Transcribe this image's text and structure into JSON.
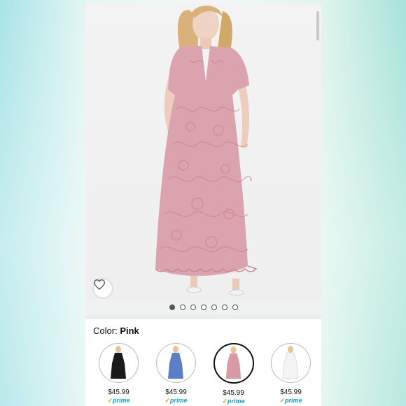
{
  "product": {
    "images_count": 7,
    "active_image_index": 0
  },
  "color_selector": {
    "label": "Color:",
    "selected": "Pink",
    "options": [
      {
        "color_hex": "#1a1a1a",
        "price": "$45.99",
        "prime": "prime"
      },
      {
        "color_hex": "#5b7fc4",
        "price": "$45.99",
        "prime": "prime"
      },
      {
        "color_hex": "#d99aa6",
        "price": "$45.99",
        "prime": "prime"
      },
      {
        "color_hex": "#f4f4f4",
        "price": "$45.99",
        "prime": "prime"
      }
    ]
  },
  "colors": {
    "accent_prime": "#00a8e1",
    "dress_pink": "#d9a0aa"
  }
}
